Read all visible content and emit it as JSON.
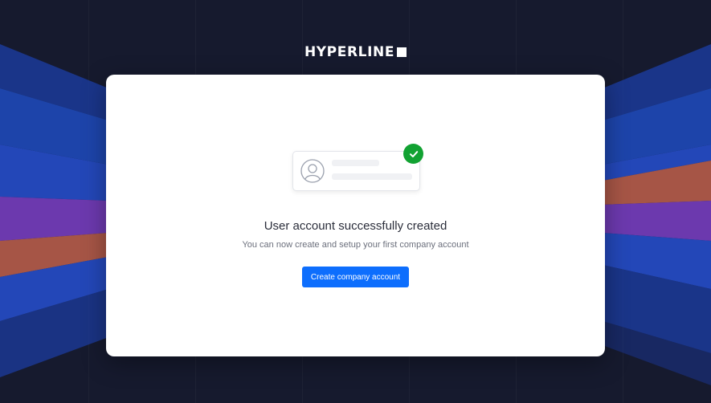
{
  "brand": {
    "name": "HYPERLINE"
  },
  "card": {
    "title": "User account successfully created",
    "subtitle": "You can now create and setup your first company account",
    "button_label": "Create company account"
  },
  "icons": {
    "logo_mark": "square-icon",
    "avatar": "user-avatar-icon",
    "success": "checkmark-icon"
  },
  "colors": {
    "background": "#161a2e",
    "card": "#ffffff",
    "primary_button": "#0d6efd",
    "success": "#12a232",
    "band_blue": "#1e4fc7",
    "band_purple": "#7b3fc4",
    "band_orange": "#c0604a"
  }
}
